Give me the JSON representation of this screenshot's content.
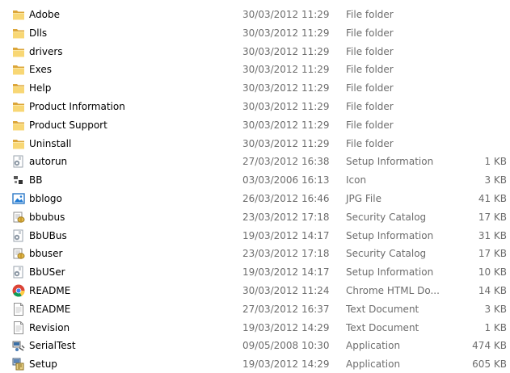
{
  "files": [
    {
      "name": "Adobe",
      "date": "30/03/2012 11:29",
      "type": "File folder",
      "size": "",
      "icon": "folder-icon"
    },
    {
      "name": "Dlls",
      "date": "30/03/2012 11:29",
      "type": "File folder",
      "size": "",
      "icon": "folder-icon"
    },
    {
      "name": "drivers",
      "date": "30/03/2012 11:29",
      "type": "File folder",
      "size": "",
      "icon": "folder-icon"
    },
    {
      "name": "Exes",
      "date": "30/03/2012 11:29",
      "type": "File folder",
      "size": "",
      "icon": "folder-icon"
    },
    {
      "name": "Help",
      "date": "30/03/2012 11:29",
      "type": "File folder",
      "size": "",
      "icon": "folder-icon"
    },
    {
      "name": "Product Information",
      "date": "30/03/2012 11:29",
      "type": "File folder",
      "size": "",
      "icon": "folder-icon"
    },
    {
      "name": "Product Support",
      "date": "30/03/2012 11:29",
      "type": "File folder",
      "size": "",
      "icon": "folder-icon"
    },
    {
      "name": "Uninstall",
      "date": "30/03/2012 11:29",
      "type": "File folder",
      "size": "",
      "icon": "folder-icon"
    },
    {
      "name": "autorun",
      "date": "27/03/2012 16:38",
      "type": "Setup Information",
      "size": "1 KB",
      "icon": "setup-info-icon"
    },
    {
      "name": "BB",
      "date": "03/03/2006 16:13",
      "type": "Icon",
      "size": "3 KB",
      "icon": "icon-file-icon"
    },
    {
      "name": "bblogo",
      "date": "26/03/2012 16:46",
      "type": "JPG File",
      "size": "41 KB",
      "icon": "image-file-icon"
    },
    {
      "name": "bbubus",
      "date": "23/03/2012 17:18",
      "type": "Security Catalog",
      "size": "17 KB",
      "icon": "security-catalog-icon"
    },
    {
      "name": "BbUBus",
      "date": "19/03/2012 14:17",
      "type": "Setup Information",
      "size": "31 KB",
      "icon": "setup-info-icon"
    },
    {
      "name": "bbuser",
      "date": "23/03/2012 17:18",
      "type": "Security Catalog",
      "size": "17 KB",
      "icon": "security-catalog-icon"
    },
    {
      "name": "BbUSer",
      "date": "19/03/2012 14:17",
      "type": "Setup Information",
      "size": "10 KB",
      "icon": "setup-info-icon"
    },
    {
      "name": "README",
      "date": "30/03/2012 11:24",
      "type": "Chrome HTML Do...",
      "size": "14 KB",
      "icon": "chrome-icon"
    },
    {
      "name": "README",
      "date": "27/03/2012 16:37",
      "type": "Text Document",
      "size": "3 KB",
      "icon": "text-document-icon"
    },
    {
      "name": "Revision",
      "date": "19/03/2012 14:29",
      "type": "Text Document",
      "size": "1 KB",
      "icon": "text-document-icon"
    },
    {
      "name": "SerialTest",
      "date": "09/05/2008 10:30",
      "type": "Application",
      "size": "474 KB",
      "icon": "application-icon"
    },
    {
      "name": "Setup",
      "date": "19/03/2012 14:29",
      "type": "Application",
      "size": "605 KB",
      "icon": "setup-application-icon"
    }
  ]
}
